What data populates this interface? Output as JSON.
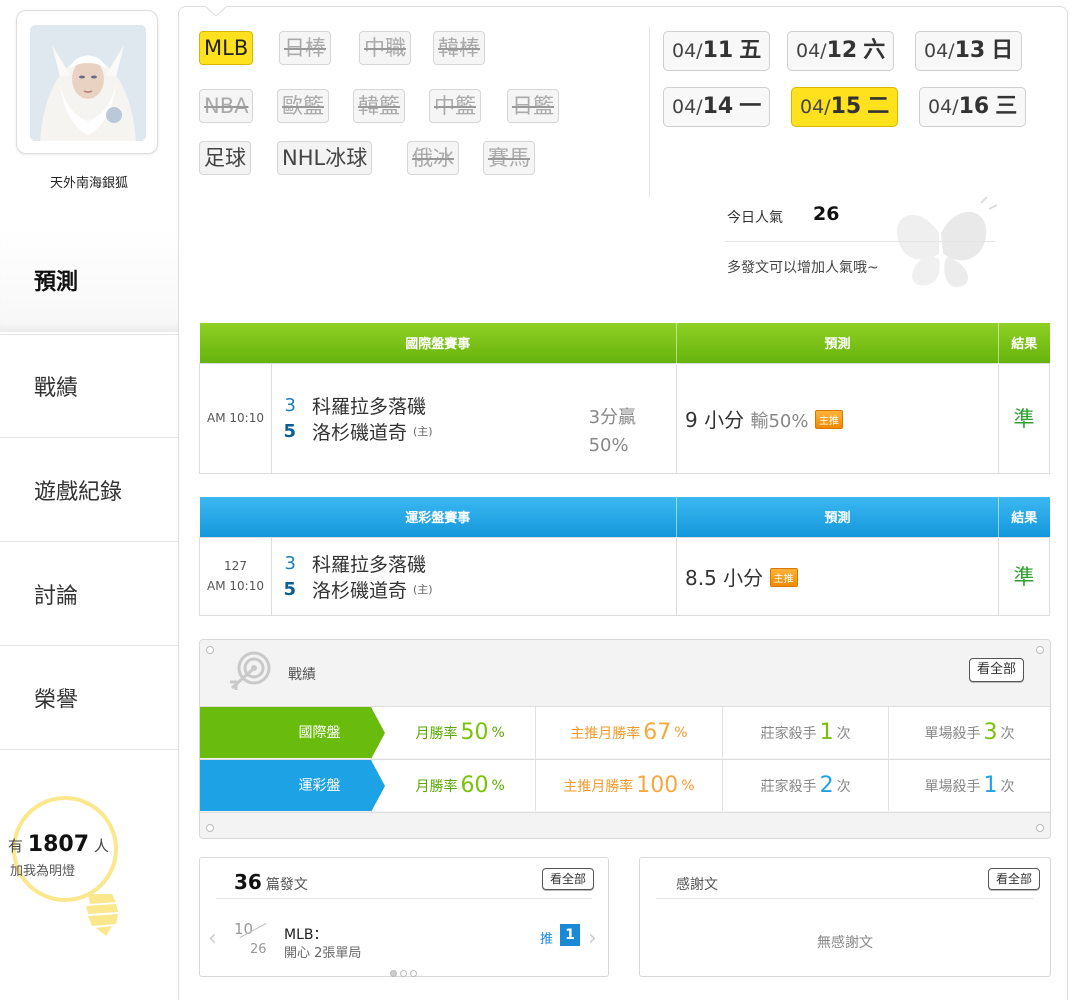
{
  "user": {
    "name": "天外南海銀狐"
  },
  "nav": [
    {
      "label": "預測"
    },
    {
      "label": "戰績"
    },
    {
      "label": "遊戲紀錄"
    },
    {
      "label": "討論"
    },
    {
      "label": "榮譽"
    }
  ],
  "fans": {
    "prefix": "有",
    "count": "1807",
    "suffix": "人",
    "line2": "加我為明燈"
  },
  "leagues": [
    {
      "label": "MLB"
    },
    {
      "label": "日棒"
    },
    {
      "label": "中職"
    },
    {
      "label": "韓棒"
    },
    {
      "label": "NBA"
    },
    {
      "label": "歐籃"
    },
    {
      "label": "韓籃"
    },
    {
      "label": "中籃"
    },
    {
      "label": "日籃"
    },
    {
      "label": "足球"
    },
    {
      "label": "NHL冰球"
    },
    {
      "label": "俄冰"
    },
    {
      "label": "賽馬"
    }
  ],
  "dates": [
    {
      "md": "04/",
      "day": "11",
      "wk": "五"
    },
    {
      "md": "04/",
      "day": "12",
      "wk": "六"
    },
    {
      "md": "04/",
      "day": "13",
      "wk": "日"
    },
    {
      "md": "04/",
      "day": "14",
      "wk": "一"
    },
    {
      "md": "04/",
      "day": "15",
      "wk": "二"
    },
    {
      "md": "04/",
      "day": "16",
      "wk": "三"
    }
  ],
  "popularity": {
    "label": "今日人氣",
    "value": "26",
    "hint": "多發文可以增加人氣哦~"
  },
  "intl_table": {
    "headers": [
      "國際盤賽事",
      "預測",
      "結果"
    ],
    "time": "AM 10:10",
    "away_score": "3",
    "away_team": "科羅拉多落磯",
    "home_score": "5",
    "home_team": "洛杉磯道奇",
    "home_mark": "(主)",
    "handicap_line1": "3分贏",
    "handicap_line2": "50%",
    "pred_main": "9 小分",
    "pred_sub": "輸50%",
    "badge": "主推",
    "result": "準"
  },
  "lottery_table": {
    "headers": [
      "運彩盤賽事",
      "預測",
      "結果"
    ],
    "game_no": "127",
    "time": "AM 10:10",
    "away_score": "3",
    "away_team": "科羅拉多落磯",
    "home_score": "5",
    "home_team": "洛杉磯道奇",
    "home_mark": "(主)",
    "pred_main": "8.5 小分",
    "badge": "主推",
    "result": "準"
  },
  "record": {
    "title": "戰績",
    "view_all": "看全部",
    "rows": [
      {
        "label": "國際盤",
        "month_pre": "月勝率",
        "month_val": "50",
        "month_unit": "%",
        "main_pre": "主推月勝率",
        "main_val": "67",
        "main_unit": "%",
        "book_pre": "莊家殺手",
        "book_val": "1",
        "book_unit": "次",
        "single_pre": "單場殺手",
        "single_val": "3",
        "single_unit": "次"
      },
      {
        "label": "運彩盤",
        "month_pre": "月勝率",
        "month_val": "60",
        "month_unit": "%",
        "main_pre": "主推月勝率",
        "main_val": "100",
        "main_unit": "%",
        "book_pre": "莊家殺手",
        "book_val": "2",
        "book_unit": "次",
        "single_pre": "單場殺手",
        "single_val": "1",
        "single_unit": "次"
      }
    ]
  },
  "posts": {
    "count": "36",
    "label": "篇發文",
    "view_all": "看全部",
    "item": {
      "month": "10",
      "day": "26",
      "category": "MLB：",
      "title": "開心 2張單局",
      "push_label": "推",
      "push_count": "1"
    },
    "arrow_prev": "‹",
    "arrow_next": "›"
  },
  "thanks": {
    "label": "感謝文",
    "view_all": "看全部",
    "empty": "無感謝文"
  }
}
